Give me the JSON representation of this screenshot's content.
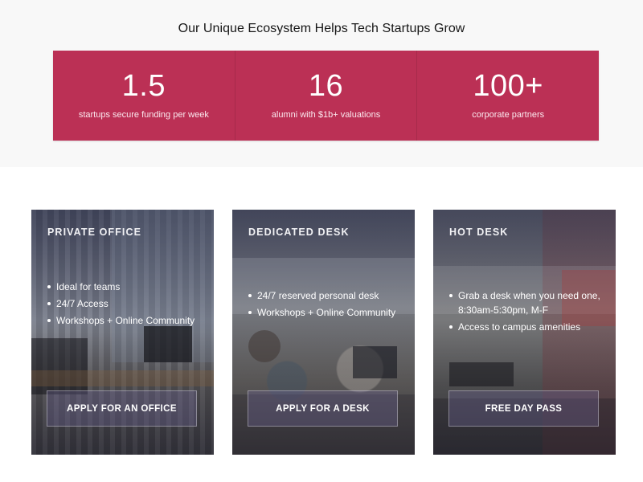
{
  "stats": {
    "title": "Our Unique Ecosystem Helps Tech Startups Grow",
    "accent_color": "#bb3055",
    "items": [
      {
        "value": "1.5",
        "label": "startups secure funding per week"
      },
      {
        "value": "16",
        "label": "alumni with $1b+ valuations"
      },
      {
        "value": "100+",
        "label": "corporate partners"
      }
    ]
  },
  "plans": [
    {
      "title": "PRIVATE OFFICE",
      "features": [
        "Ideal for teams",
        "24/7 Access",
        "Workshops + Online Community"
      ],
      "cta": "APPLY FOR AN OFFICE"
    },
    {
      "title": "DEDICATED DESK",
      "features": [
        "24/7 reserved personal desk",
        "Workshops + Online Community"
      ],
      "cta": "APPLY FOR A DESK"
    },
    {
      "title": "HOT DESK",
      "features": [
        "Grab a desk when you need one, 8:30am-5:30pm, M-F",
        "Access to campus amenities"
      ],
      "cta": "FREE DAY PASS"
    }
  ]
}
